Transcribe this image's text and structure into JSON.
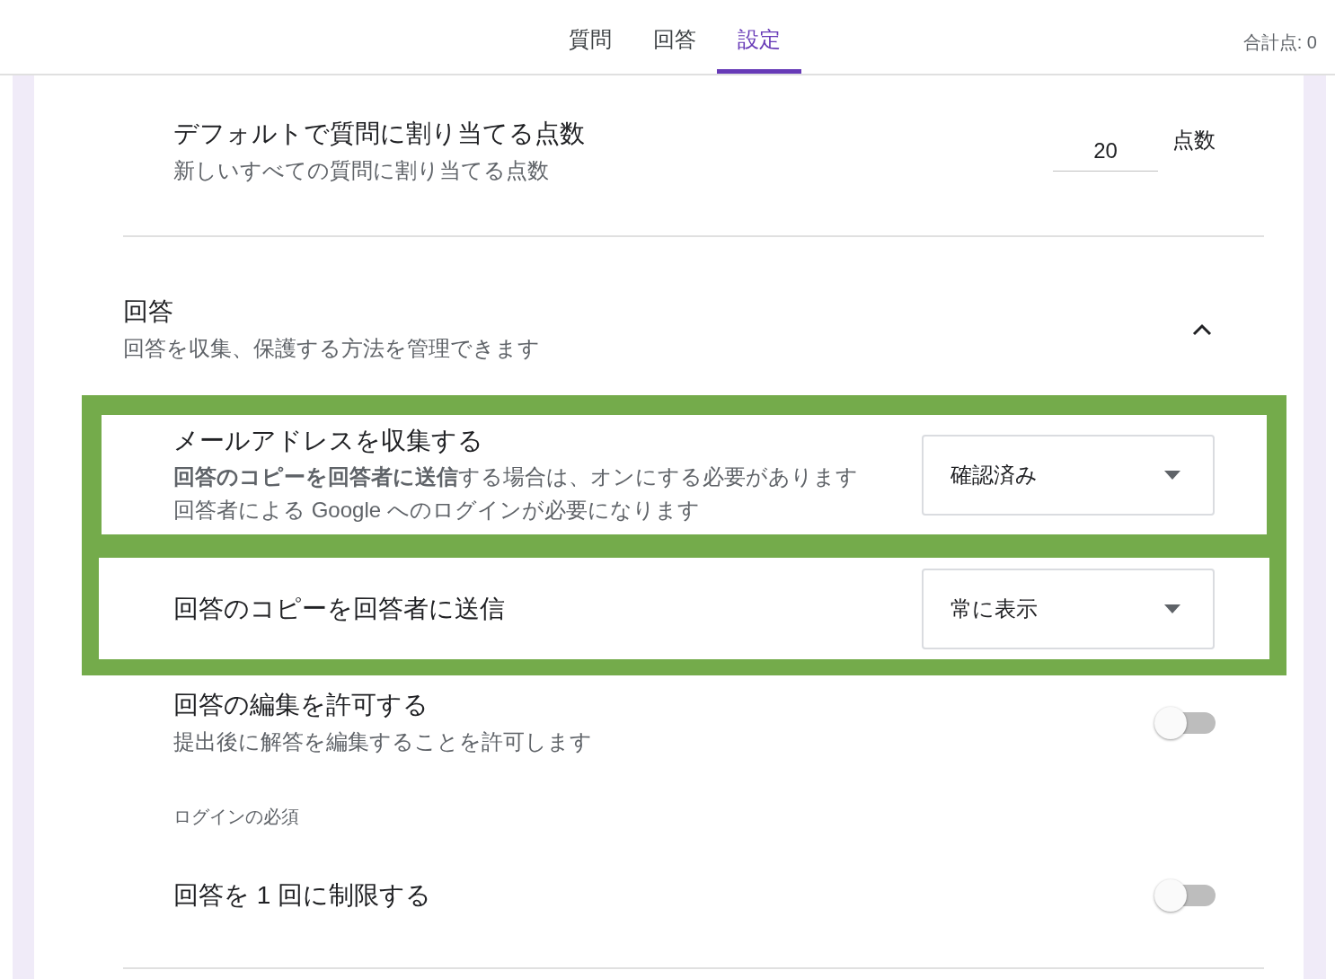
{
  "tabs": [
    {
      "label": "質問",
      "selected": false
    },
    {
      "label": "回答",
      "selected": false
    },
    {
      "label": "設定",
      "selected": true
    }
  ],
  "total_points": "合計点: 0",
  "default_points": {
    "title": "デフォルトで質問に割り当てる点数",
    "description": "新しいすべての質問に割り当てる点数",
    "value": "20",
    "unit": "点数"
  },
  "section": {
    "title": "回答",
    "description": "回答を収集、保護する方法を管理できます",
    "expanded": true
  },
  "highlighted_settings": [
    {
      "title": "メールアドレスを収集する",
      "description": "**回答のコピーを回答者に送信**する場合は、オンにする必要があります",
      "note": "回答者による Google へのログインが必要になります",
      "value": "確認済み"
    },
    {
      "title": "回答のコピーを回答者に送信",
      "value": "常に表示"
    }
  ],
  "settings": [
    {
      "kind": "toggle",
      "title": "回答の編集を許可する",
      "description": "提出後に解答を編集することを許可します",
      "on": false
    },
    {
      "kind": "heading",
      "title": "ログインの必須"
    },
    {
      "kind": "toggle",
      "title": "回答を 1 回に制限する",
      "on": false
    }
  ]
}
